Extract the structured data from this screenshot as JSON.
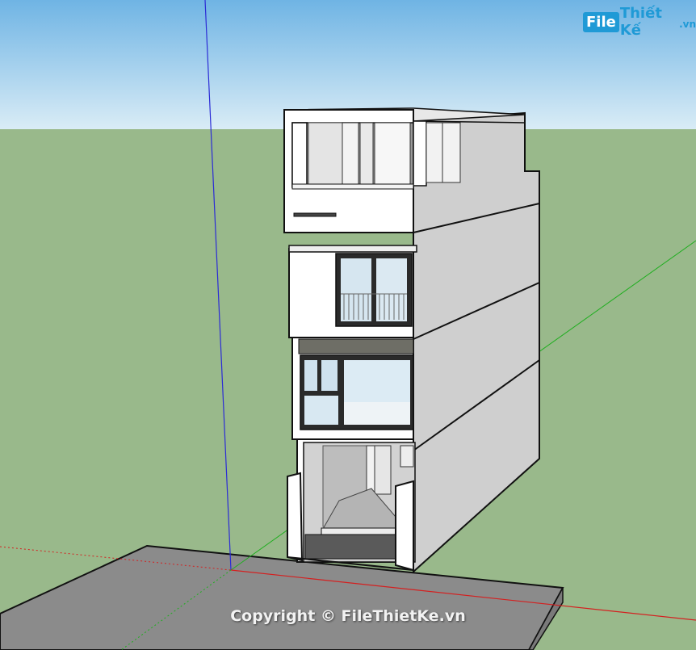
{
  "watermark": {
    "logo_box": "File",
    "logo_rest": "Thiết Kế",
    "logo_suffix": ".vn",
    "copyright": "Copyright © FileThietKe.vn"
  },
  "colors": {
    "sky_top": "#6fb4e4",
    "sky_bottom": "#d9ecf6",
    "ground": "#99b98b",
    "slab": "#8a8a8a",
    "wall_front": "#ffffff",
    "wall_side": "#d0d0d0",
    "window_frame": "#222222",
    "glass": "#cfe2ef",
    "axis_blue": "#2b2bd6",
    "axis_green": "#1fae1f",
    "axis_red": "#d42020",
    "brand": "#1f9ad6"
  }
}
